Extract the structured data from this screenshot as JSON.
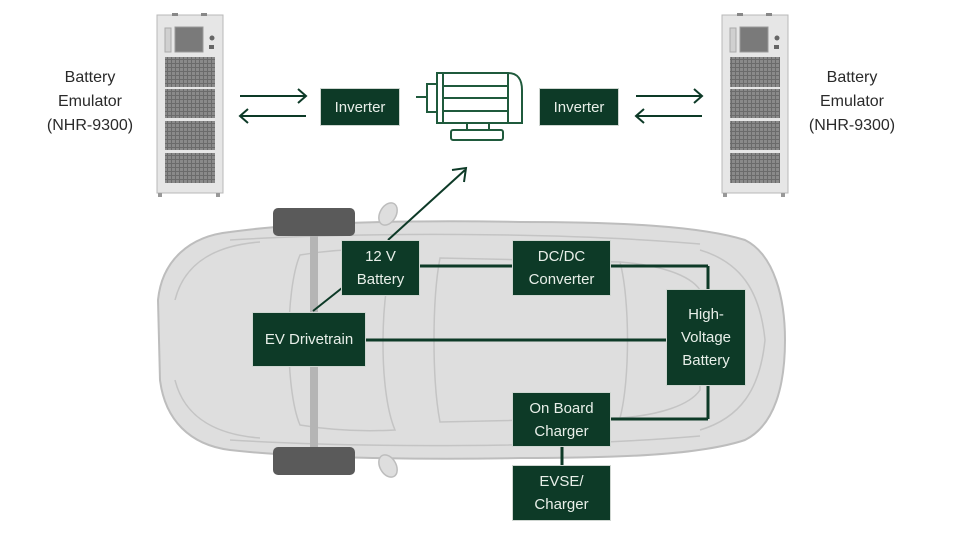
{
  "colors": {
    "accent": "#0d3a27",
    "box_text": "#e8efe9",
    "car_body": "#dcdcdc",
    "car_outline": "#bdbdbd",
    "wheel": "#5a5a5a"
  },
  "top": {
    "left_emulator": {
      "icon": "battery-emulator-cabinet-icon",
      "label": "Battery\nEmulator\n(NHR-9300)"
    },
    "right_emulator": {
      "icon": "battery-emulator-cabinet-icon",
      "label": "Battery\nEmulator\n(NHR-9300)"
    },
    "left_inverter": "Inverter",
    "right_inverter": "Inverter",
    "motor_icon": "electric-motor-icon"
  },
  "car": {
    "blocks": {
      "battery_12v": "12 V\nBattery",
      "dcdc": "DC/DC\nConverter",
      "drivetrain": "EV Drivetrain",
      "hv_battery": "High-\nVoltage\nBattery",
      "obc": "On Board\nCharger",
      "evse": "EVSE/\nCharger"
    }
  }
}
